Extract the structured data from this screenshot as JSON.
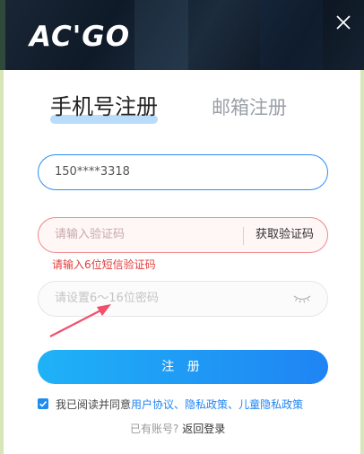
{
  "header": {
    "logo_text": "AC'GO",
    "close_icon": "close-icon"
  },
  "tabs": {
    "phone_label": "手机号注册",
    "email_label": "邮箱注册"
  },
  "form": {
    "phone_value": "150****3318",
    "code_placeholder": "请输入验证码",
    "get_code_label": "获取验证码",
    "code_error": "请输入6位短信验证码",
    "password_placeholder": "请设置6～16位密码",
    "submit_label": "注 册"
  },
  "agreement": {
    "checked": true,
    "prefix": "我已阅读并同意",
    "user_agreement": "用户协议",
    "sep1": "、",
    "privacy_policy": "隐私政策",
    "sep2": "、",
    "child_privacy": "儿童隐私政策"
  },
  "footer": {
    "have_account": "已有账号?",
    "back_login": "返回登录"
  },
  "colors": {
    "accent": "#1f84f3",
    "error": "#e23c3c"
  }
}
